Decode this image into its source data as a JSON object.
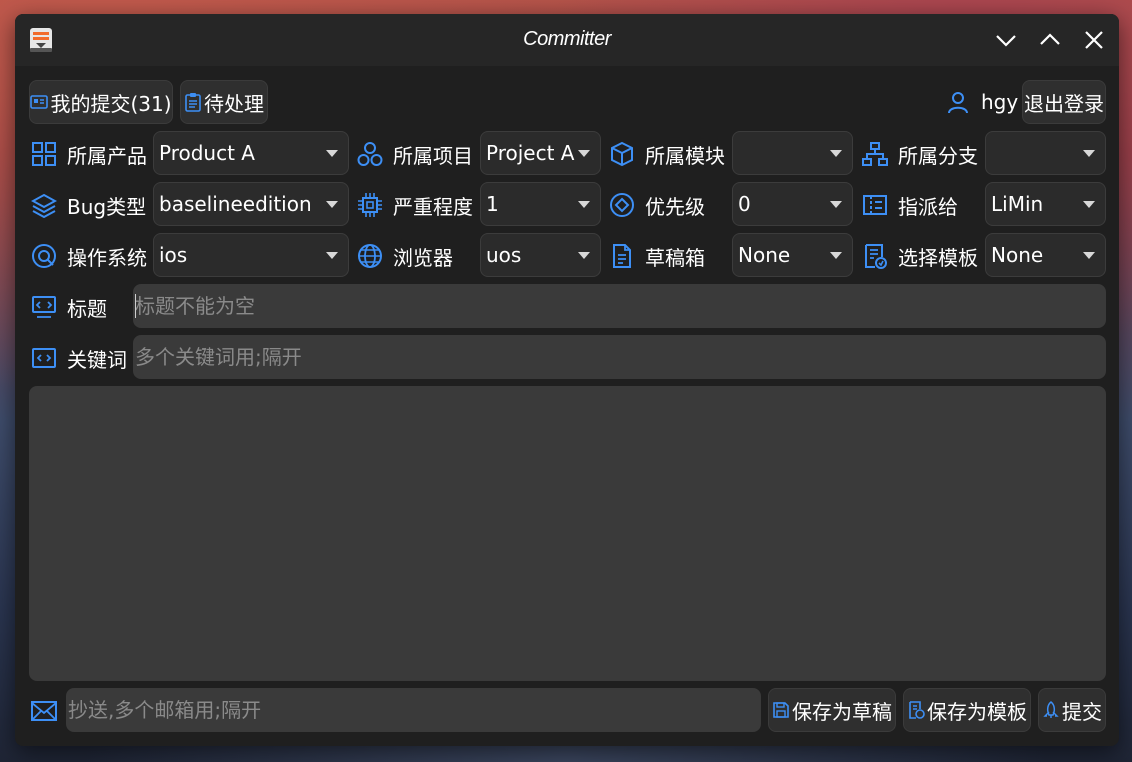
{
  "window": {
    "title": "Committer"
  },
  "toolbar": {
    "my_commits_label": "我的提交(31)",
    "pending_label": "待处理",
    "username": "hgy",
    "logout_label": "退出登录"
  },
  "fields": {
    "product": {
      "label": "所属产品",
      "value": "Product A"
    },
    "project": {
      "label": "所属项目",
      "value": "Project A"
    },
    "module": {
      "label": "所属模块",
      "value": ""
    },
    "branch": {
      "label": "所属分支",
      "value": ""
    },
    "bug_type": {
      "label": "Bug类型",
      "value": "baselineedition"
    },
    "severity": {
      "label": "严重程度",
      "value": "1"
    },
    "priority": {
      "label": "优先级",
      "value": "0"
    },
    "assignee": {
      "label": "指派给",
      "value": "LiMin"
    },
    "os": {
      "label": "操作系统",
      "value": "ios"
    },
    "browser": {
      "label": "浏览器",
      "value": "uos"
    },
    "drafts": {
      "label": "草稿箱",
      "value": "None"
    },
    "template": {
      "label": "选择模板",
      "value": "None"
    }
  },
  "title_field": {
    "label": "标题",
    "placeholder": "标题不能为空",
    "value": ""
  },
  "keywords_field": {
    "label": "关键词",
    "placeholder": "多个关键词用;隔开",
    "value": ""
  },
  "description": {
    "value": ""
  },
  "footer": {
    "cc_placeholder": "抄送,多个邮箱用;隔开",
    "save_draft_label": "保存为草稿",
    "save_template_label": "保存为模板",
    "submit_label": "提交"
  },
  "colors": {
    "accent": "#3d8ff5",
    "window_bg": "#1f1f1f",
    "titlebar_bg": "#262626",
    "field_bg": "#3a3a3a",
    "combo_bg": "#2b2b2b",
    "app_icon_orange": "#f26b2a"
  },
  "icons": {
    "app": "app-document-icon",
    "minimize": "chevron-down-icon",
    "maximize": "chevron-up-icon",
    "close": "close-icon",
    "user": "user-icon"
  }
}
